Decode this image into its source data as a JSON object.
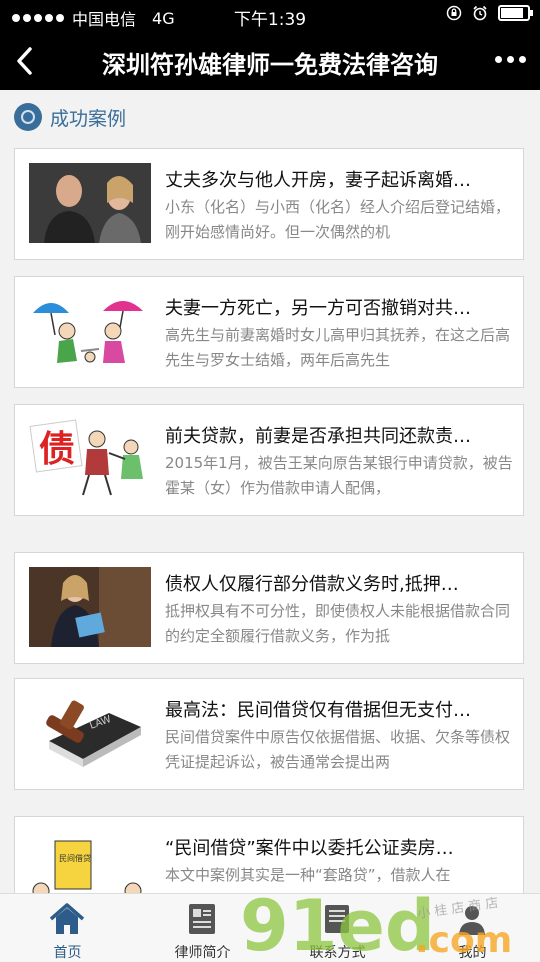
{
  "status_bar": {
    "carrier": "中国电信",
    "network": "4G",
    "time": "下午1:39",
    "battery_level": 0.85
  },
  "nav": {
    "title": "深圳符孙雄律师一免费法律咨询",
    "back_icon": "back-arrow-icon",
    "more_icon": "more-dots-icon"
  },
  "section": {
    "title": "成功案例"
  },
  "cases": [
    {
      "title": "丈夫多次与他人开房，妻子起诉离婚…",
      "desc": "小东（化名）与小西（化名）经人介绍后登记结婚，刚开始感情尚好。但一次偶然的机",
      "image": "arguing-couple-photo"
    },
    {
      "title": "夫妻一方死亡，另一方可否撤销对共…",
      "desc": "高先生与前妻离婚时女儿高甲归其抚养，在这之后高先生与罗女士结婚，两年后高先生",
      "image": "divorce-umbrella-cartoon"
    },
    {
      "title": "前夫贷款，前妻是否承担共同还款责…",
      "desc": "2015年1月，被告王某向原告某银行申请贷款，被告霍某（女）作为借款申请人配偶，",
      "image": "debt-cartoon",
      "image_text": "债"
    },
    {
      "title": "债权人仅履行部分借款义务时,抵押…",
      "desc": "抵押权具有不可分性，即使债权人未能根据借款合同的约定全额履行借款义务，作为抵",
      "image": "businesswoman-photo"
    },
    {
      "title": "最高法：民间借贷仅有借据但无支付…",
      "desc": "民间借贷案件中原告仅依据借据、收据、欠条等债权凭证提起诉讼，被告通常会提出两",
      "image": "law-book-gavel",
      "image_text": "LAW"
    },
    {
      "title": "“民间借贷”案件中以委托公证卖房…",
      "desc": "本文中案例其实是一种“套路贷”，借款人在",
      "image": "private-lending-cartoon",
      "image_text": "民间借贷"
    }
  ],
  "tabs": [
    {
      "label": "首页",
      "icon": "home-icon"
    },
    {
      "label": "律师简介",
      "icon": "profile-card-icon"
    },
    {
      "label": "联系方式",
      "icon": "contact-icon"
    },
    {
      "label": "我的",
      "icon": "user-icon"
    }
  ],
  "watermark": {
    "text": "91ed",
    "suffix": ".com",
    "script": "小 桂 店 商 店"
  },
  "colors": {
    "accent": "#2d5c8a",
    "nav_bg": "#000000",
    "watermark_green": "#8cc63f",
    "watermark_orange": "#f5a623"
  }
}
